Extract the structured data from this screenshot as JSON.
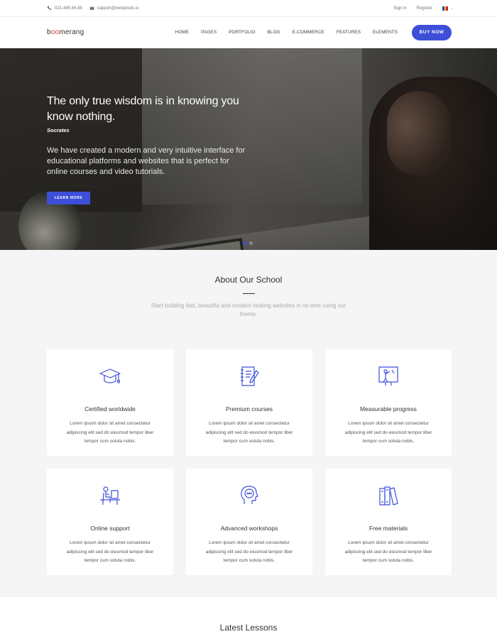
{
  "topbar": {
    "phone": "021-485.66.88",
    "email": "support@webpixels.io",
    "signin": "Sign in",
    "register": "Register",
    "language_dropdown": "⌄"
  },
  "nav": {
    "logo_prefix": "b",
    "logo_o1": "o",
    "logo_o2": "o",
    "logo_suffix": "merang",
    "items": [
      "HOME",
      "PAGES",
      "PORTFOLIO",
      "BLOG",
      "E-COMMERCE",
      "FEATURES",
      "ELEMENTS"
    ],
    "buy_label": "BUY NOW"
  },
  "hero": {
    "headline": "The only true wisdom is in knowing you know nothing.",
    "author": "Socrates",
    "description": "We have created a modern and very intuitive interface for educational platforms and websites that is perfect for online courses and video tutorials.",
    "button": "LEARN MORE"
  },
  "about": {
    "title": "About Our School",
    "subtitle": "Start building fast, beautiful and modern looking websites in no time using our theme.",
    "cards": [
      {
        "title": "Certified worldwide",
        "text": "Lorem ipsum dolor sit amet consectetur adipiscing elit sed do eiusmod tempor liber tempor cum soluta nobis.",
        "icon": "graduation-cap-icon"
      },
      {
        "title": "Premium courses",
        "text": "Lorem ipsum dolor sit amet consectetur adipiscing elit sed do eiusmod tempor liber tempor cum soluta nobis.",
        "icon": "notebook-pen-icon"
      },
      {
        "title": "Measurable progress",
        "text": "Lorem ipsum dolor sit amet consectetur adipiscing elit sed do eiusmod tempor liber tempor cum soluta nobis.",
        "icon": "presentation-board-icon"
      },
      {
        "title": "Online support",
        "text": "Lorem ipsum dolor sit amet consectetur adipiscing elit sed do eiusmod tempor liber tempor cum soluta nobis.",
        "icon": "person-at-desk-icon"
      },
      {
        "title": "Advanced workshops",
        "text": "Lorem ipsum dolor sit amet consectetur adipiscing elit sed do eiusmod tempor liber tempor cum soluta nobis.",
        "icon": "head-chat-icon"
      },
      {
        "title": "Free materials",
        "text": "Lorem ipsum dolor sit amet consectetur adipiscing elit sed do eiusmod tempor liber tempor cum soluta nobis.",
        "icon": "books-icon"
      }
    ]
  },
  "latest": {
    "title": "Latest Lessons"
  },
  "colors": {
    "accent": "#3d4fd8",
    "logo_accent": "#d23a3a"
  }
}
